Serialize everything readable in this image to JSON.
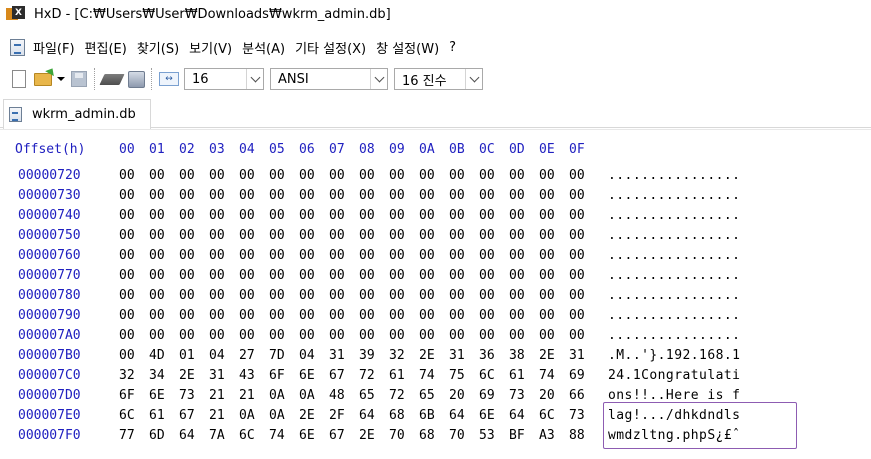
{
  "window": {
    "title": "HxD - [C:₩Users₩User₩Downloads₩wkrm_admin.db]"
  },
  "menu": {
    "items": [
      "파일(F)",
      "편집(E)",
      "찾기(S)",
      "보기(V)",
      "분석(A)",
      "기타 설정(X)",
      "창 설정(W)",
      "?"
    ]
  },
  "toolbar": {
    "bytes_per_row": "16",
    "charset": "ANSI",
    "offset_base": "16 진수"
  },
  "tab": {
    "label": "wkrm_admin.db"
  },
  "hex": {
    "offset_header": "Offset(h)",
    "column_headers": [
      "00",
      "01",
      "02",
      "03",
      "04",
      "05",
      "06",
      "07",
      "08",
      "09",
      "0A",
      "0B",
      "0C",
      "0D",
      "0E",
      "0F"
    ],
    "rows": [
      {
        "offset": "00000720",
        "bytes": [
          "00",
          "00",
          "00",
          "00",
          "00",
          "00",
          "00",
          "00",
          "00",
          "00",
          "00",
          "00",
          "00",
          "00",
          "00",
          "00"
        ],
        "ascii": "................"
      },
      {
        "offset": "00000730",
        "bytes": [
          "00",
          "00",
          "00",
          "00",
          "00",
          "00",
          "00",
          "00",
          "00",
          "00",
          "00",
          "00",
          "00",
          "00",
          "00",
          "00"
        ],
        "ascii": "................"
      },
      {
        "offset": "00000740",
        "bytes": [
          "00",
          "00",
          "00",
          "00",
          "00",
          "00",
          "00",
          "00",
          "00",
          "00",
          "00",
          "00",
          "00",
          "00",
          "00",
          "00"
        ],
        "ascii": "................"
      },
      {
        "offset": "00000750",
        "bytes": [
          "00",
          "00",
          "00",
          "00",
          "00",
          "00",
          "00",
          "00",
          "00",
          "00",
          "00",
          "00",
          "00",
          "00",
          "00",
          "00"
        ],
        "ascii": "................"
      },
      {
        "offset": "00000760",
        "bytes": [
          "00",
          "00",
          "00",
          "00",
          "00",
          "00",
          "00",
          "00",
          "00",
          "00",
          "00",
          "00",
          "00",
          "00",
          "00",
          "00"
        ],
        "ascii": "................"
      },
      {
        "offset": "00000770",
        "bytes": [
          "00",
          "00",
          "00",
          "00",
          "00",
          "00",
          "00",
          "00",
          "00",
          "00",
          "00",
          "00",
          "00",
          "00",
          "00",
          "00"
        ],
        "ascii": "................"
      },
      {
        "offset": "00000780",
        "bytes": [
          "00",
          "00",
          "00",
          "00",
          "00",
          "00",
          "00",
          "00",
          "00",
          "00",
          "00",
          "00",
          "00",
          "00",
          "00",
          "00"
        ],
        "ascii": "................"
      },
      {
        "offset": "00000790",
        "bytes": [
          "00",
          "00",
          "00",
          "00",
          "00",
          "00",
          "00",
          "00",
          "00",
          "00",
          "00",
          "00",
          "00",
          "00",
          "00",
          "00"
        ],
        "ascii": "................"
      },
      {
        "offset": "000007A0",
        "bytes": [
          "00",
          "00",
          "00",
          "00",
          "00",
          "00",
          "00",
          "00",
          "00",
          "00",
          "00",
          "00",
          "00",
          "00",
          "00",
          "00"
        ],
        "ascii": "................"
      },
      {
        "offset": "000007B0",
        "bytes": [
          "00",
          "4D",
          "01",
          "04",
          "27",
          "7D",
          "04",
          "31",
          "39",
          "32",
          "2E",
          "31",
          "36",
          "38",
          "2E",
          "31"
        ],
        "ascii": ".M..'}.192.168.1"
      },
      {
        "offset": "000007C0",
        "bytes": [
          "32",
          "34",
          "2E",
          "31",
          "43",
          "6F",
          "6E",
          "67",
          "72",
          "61",
          "74",
          "75",
          "6C",
          "61",
          "74",
          "69"
        ],
        "ascii": "24.1Congratulati"
      },
      {
        "offset": "000007D0",
        "bytes": [
          "6F",
          "6E",
          "73",
          "21",
          "21",
          "0A",
          "0A",
          "48",
          "65",
          "72",
          "65",
          "20",
          "69",
          "73",
          "20",
          "66"
        ],
        "ascii": "ons!!..Here is f"
      },
      {
        "offset": "000007E0",
        "bytes": [
          "6C",
          "61",
          "67",
          "21",
          "0A",
          "0A",
          "2E",
          "2F",
          "64",
          "68",
          "6B",
          "64",
          "6E",
          "64",
          "6C",
          "73"
        ],
        "ascii": "lag!.../dhkdndls"
      },
      {
        "offset": "000007F0",
        "bytes": [
          "77",
          "6D",
          "64",
          "7A",
          "6C",
          "74",
          "6E",
          "67",
          "2E",
          "70",
          "68",
          "70",
          "53",
          "BF",
          "A3",
          "88"
        ],
        "ascii": "wmdzltng.phpS¿£ˆ"
      }
    ]
  },
  "colors": {
    "offset_blue": "#2020c0",
    "highlight_purple": "#8d5cb2"
  }
}
